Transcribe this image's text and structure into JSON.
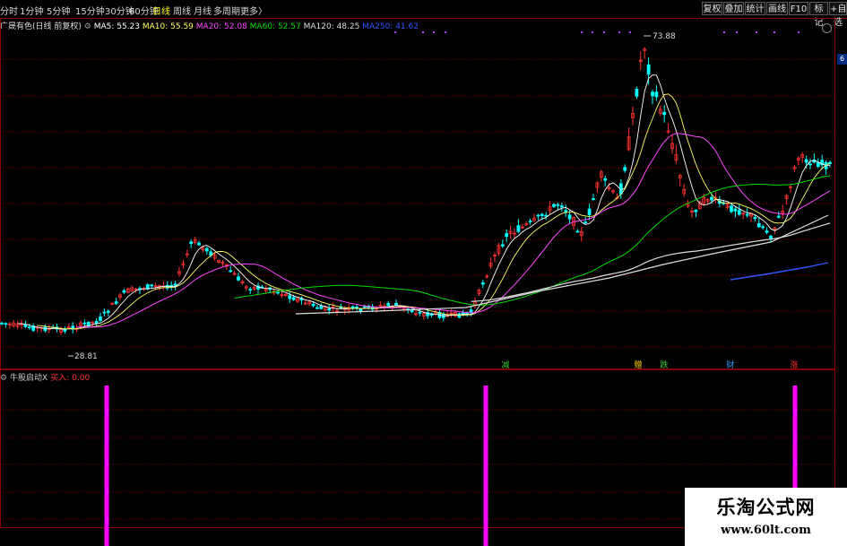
{
  "toolbar": {
    "timeframes": [
      "分时",
      "1分钟",
      "5分钟",
      "15分钟",
      "30分钟",
      "60分钟",
      "日线",
      "周线",
      "月线",
      "多周期",
      "更多〉"
    ],
    "active": "日线",
    "buttons": [
      "复权",
      "叠加",
      "统计",
      "画线",
      "F10",
      "标记",
      "+自选"
    ]
  },
  "legend": {
    "stock": "广晟有色(日线 前复权)",
    "ma": [
      {
        "label": "MA5: 55.23",
        "color": "#ffffff"
      },
      {
        "label": "MA10: 55.59",
        "color": "#ffff66"
      },
      {
        "label": "MA20: 52.08",
        "color": "#ff44ff"
      },
      {
        "label": "MA60: 52.57",
        "color": "#00dd00"
      },
      {
        "label": "MA120: 48.25",
        "color": "#dddddd"
      },
      {
        "label": "MA250: 41.62",
        "color": "#3355ff"
      }
    ]
  },
  "price_labels": {
    "high": "73.88",
    "low": "28.81"
  },
  "signal_labels": [
    {
      "text": "减",
      "color": "#33cc33"
    },
    {
      "text": "赠",
      "color": "#ffcc00"
    },
    {
      "text": "跌",
      "color": "#33cc33"
    },
    {
      "text": "财",
      "color": "#3399ff"
    },
    {
      "text": "涨",
      "color": "#ff3333"
    }
  ],
  "indicator": {
    "name": "牛股启动X",
    "buy_label": "买入: 0.00"
  },
  "right_badge": "6",
  "watermark": {
    "title": "乐淘公式网",
    "url": "www.60lt.com"
  },
  "colors": {
    "up": "#ff3333",
    "down": "#00ffff",
    "bar": "#ff00ff",
    "grid": "#8b0000"
  }
}
